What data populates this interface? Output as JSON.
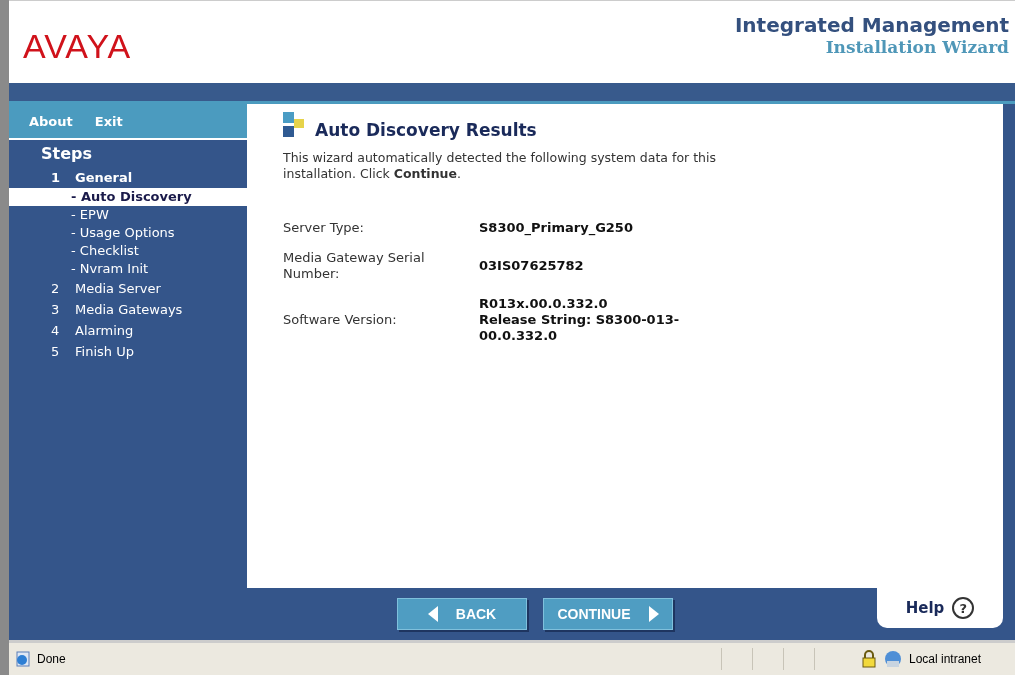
{
  "header": {
    "logo": "AVAYA",
    "title": "Integrated Management",
    "subtitle": "Installation Wizard"
  },
  "nav_links": [
    "About",
    "Exit"
  ],
  "steps_heading": "Steps",
  "steps": [
    {
      "number": "1",
      "label": "General",
      "selected": false,
      "children": [
        {
          "label": "- Auto Discovery",
          "selected": true
        },
        {
          "label": "- EPW",
          "selected": false
        },
        {
          "label": "- Usage Options",
          "selected": false
        },
        {
          "label": "- Checklist",
          "selected": false
        },
        {
          "label": "- Nvram Init",
          "selected": false
        }
      ]
    },
    {
      "number": "2",
      "label": "Media Server",
      "selected": false
    },
    {
      "number": "3",
      "label": "Media Gateways",
      "selected": false
    },
    {
      "number": "4",
      "label": "Alarming",
      "selected": false
    },
    {
      "number": "5",
      "label": "Finish Up",
      "selected": false
    }
  ],
  "page_title": "Auto Discovery Results",
  "intro": "This wizard automatically detected the following system data for this installation. Click **Continue**.",
  "fields": [
    {
      "label": "Server Type:",
      "values": [
        "S8300_Primary_G250"
      ]
    },
    {
      "label": "Media Gateway Serial Number:",
      "values": [
        "03IS07625782"
      ]
    },
    {
      "label": "Software Version:",
      "values": [
        "R013x.00.0.332.0",
        "Release String: S8300-013-00.0.332.0"
      ]
    }
  ],
  "buttons": [
    {
      "label": "BACK",
      "kind": "back"
    },
    {
      "label": "CONTINUE",
      "kind": "next"
    }
  ],
  "help": "Help",
  "help_icon": "?",
  "status_bar": {
    "text": "Done",
    "zone": "Local intranet"
  }
}
